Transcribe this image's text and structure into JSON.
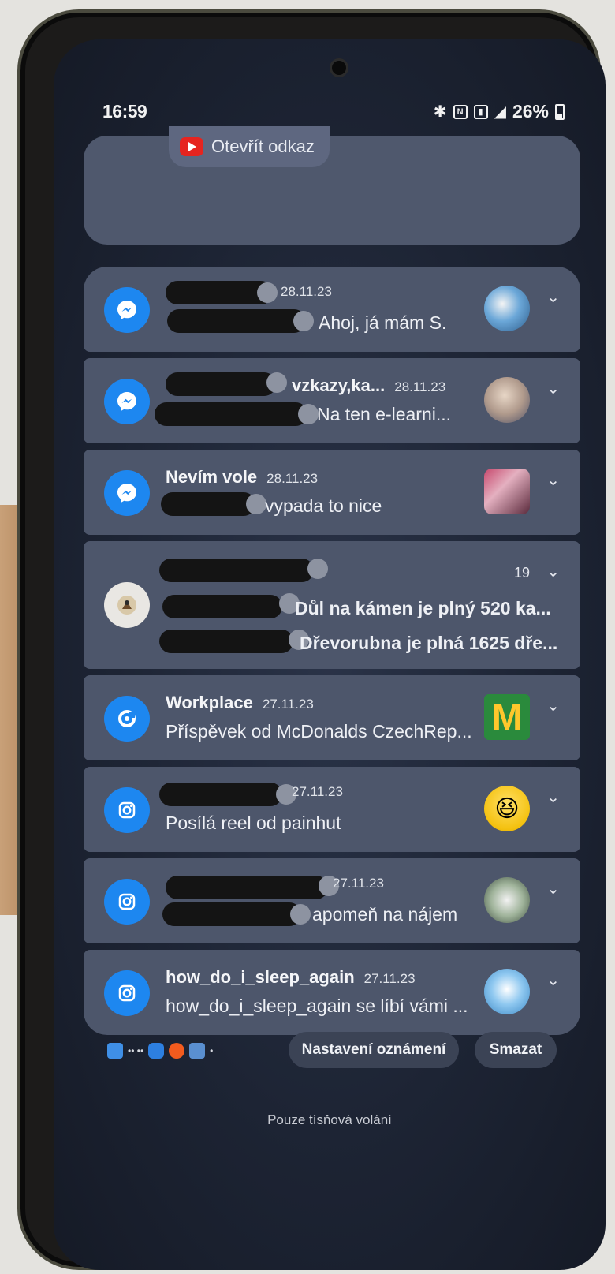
{
  "status_bar": {
    "time": "16:59",
    "battery": "26%",
    "icons": [
      "bluetooth-icon",
      "nfc-icon",
      "vibrate-icon",
      "signal-icon",
      "battery-icon"
    ]
  },
  "top_card": {
    "open_link_label": "Otevřít odkaz"
  },
  "notifications": [
    {
      "app": "messenger",
      "title_visible": "",
      "date": "28.11.23",
      "body_visible": "Ahoj, já mám S."
    },
    {
      "app": "messenger",
      "title_visible": "vzkazy,ka...",
      "date": "28.11.23",
      "body_visible": "Na ten e-learni..."
    },
    {
      "app": "messenger",
      "title_visible": "Nevím vole",
      "date": "28.11.23",
      "body_visible": "vypada to nice"
    },
    {
      "app": "game",
      "count": "19",
      "line1_visible": "Důl na kámen je plný 520 ka...",
      "line2_visible": "Dřevorubna je plná 1625 dře..."
    },
    {
      "app": "workplace",
      "title_visible": "Workplace",
      "date": "27.11.23",
      "body_visible": "Příspěvek od McDonalds CzechRep..."
    },
    {
      "app": "instagram",
      "title_visible": "",
      "date": "27.11.23",
      "body_visible": "Posílá reel od painhut"
    },
    {
      "app": "instagram",
      "title_visible": "",
      "date": "27.11.23",
      "body_visible": "apomeň na nájem"
    },
    {
      "app": "instagram",
      "title_visible": "how_do_i_sleep_again",
      "date": "27.11.23",
      "body_visible": "how_do_i_sleep_again se líbí vámi ..."
    }
  ],
  "bottom_bar": {
    "settings_label": "Nastavení oznámení",
    "clear_label": "Smazat"
  },
  "emergency_text": "Pouze tísňová volání",
  "colors": {
    "messenger_blue": "#1d87f0",
    "card": "#4d566b",
    "youtube_red": "#e6241f",
    "mcdonalds_yellow": "#ffc72c",
    "mcdonalds_green": "#2a8a3c"
  }
}
